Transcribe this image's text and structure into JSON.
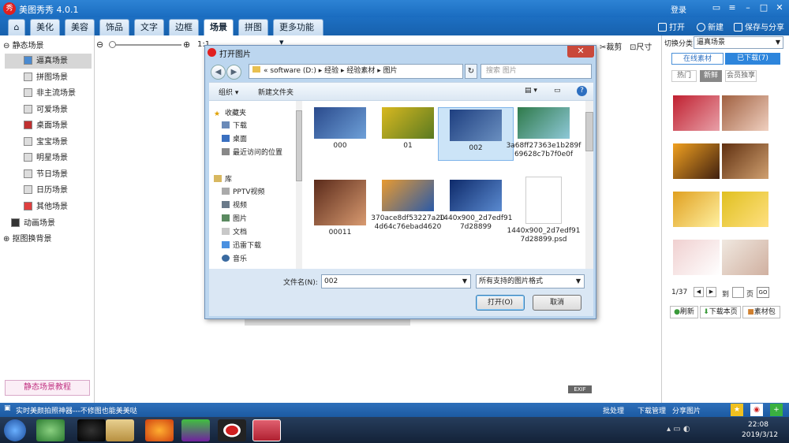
{
  "app": {
    "title": "美图秀秀 4.0.1",
    "logo": "秀",
    "login": "登录"
  },
  "menu": {
    "tabs": [
      "美化",
      "美容",
      "饰品",
      "文字",
      "边框",
      "场景",
      "拼图",
      "更多功能"
    ],
    "active": "场景",
    "open": "打开",
    "new": "新建",
    "save_share": "保存与分享"
  },
  "left": {
    "static_header": "静态场景",
    "items": [
      "逼真场景",
      "拼图场景",
      "非主流场景",
      "可爱场景",
      "桌面场景",
      "宝宝场景",
      "明星场景",
      "节日场景",
      "日历场景",
      "其他场景"
    ],
    "animated": "动画场景",
    "cutout": "抠图换背景",
    "tutorial": "静态场景教程"
  },
  "center": {
    "zoom_label": "1:1",
    "crop": "裁剪",
    "size": "尺寸"
  },
  "dialog": {
    "title": "打开图片",
    "path": [
      "software (D:)",
      "经验",
      "经验素材",
      "图片"
    ],
    "search_placeholder": "搜索 图片",
    "organize": "组织",
    "new_folder": "新建文件夹",
    "favorites": "收藏夹",
    "nav": [
      "下载",
      "桌面",
      "最近访问的位置"
    ],
    "library": "库",
    "lib_items": [
      "PPTV视频",
      "视频",
      "图片",
      "文档",
      "迅雷下载",
      "音乐"
    ],
    "files": [
      {
        "name": "000",
        "type": "img",
        "c1": "#2a4a8c",
        "c2": "#6ea0d8"
      },
      {
        "name": "01",
        "type": "img",
        "c1": "#d8b820",
        "c2": "#5a7a20"
      },
      {
        "name": "002",
        "type": "img",
        "c1": "#1e3f80",
        "c2": "#6a8fc0"
      },
      {
        "name": "3a68ff27363e1b289f69628c7b7f0e0f",
        "type": "img",
        "c1": "#2f7a4a",
        "c2": "#8ec8d8"
      },
      {
        "name": "00011",
        "type": "img",
        "c1": "#5a2a1a",
        "c2": "#d89a70"
      },
      {
        "name": "370ace8df53227a204d64c76ebad4620",
        "type": "img",
        "c1": "#e89a30",
        "c2": "#2a5aa8"
      },
      {
        "name": "1440x900_2d7edf917d28899",
        "type": "img",
        "c1": "#0e2a6a",
        "c2": "#5a8ad0"
      },
      {
        "name": "1440x900_2d7edf917d28899.psd",
        "type": "doc",
        "c1": "#ffffff",
        "c2": "#dddddd"
      }
    ],
    "filename_label": "文件名(N):",
    "filename_value": "002",
    "filter": "所有支持的图片格式",
    "open_btn": "打开(O)",
    "cancel_btn": "取消"
  },
  "right": {
    "category_label": "切换分类",
    "category_value": "逼真场景",
    "tab_online": "在线素材",
    "tab_downloaded": "已下载(7)",
    "subtabs": [
      "热门",
      "新鲜",
      "会员独享"
    ],
    "thumbs": [
      [
        "#c02030",
        "#e8a0a8"
      ],
      [
        "#a06040",
        "#f0d0c0"
      ],
      [
        "#f0a020",
        "#402010"
      ],
      [
        "#603010",
        "#d0a070"
      ],
      [
        "#e0a020",
        "#fff0a0"
      ],
      [
        "#e0c020",
        "#ffe080"
      ],
      [
        "#f0d0d0",
        "#fff"
      ],
      [
        "#f0e8e0",
        "#d0b0a0"
      ]
    ],
    "page_info": "1/37",
    "goto": "到",
    "page_unit": "页",
    "go": "GO",
    "refresh": "刷新",
    "download_page": "下载本页",
    "material_pack": "素材包"
  },
  "status": {
    "left": "实时美颜拍照神器---不修图也能美美哒",
    "batch": "批处理",
    "download_mgr": "下载管理",
    "share": "分享图片"
  },
  "taskbar": {
    "time": "22:08",
    "date": "2019/3/12"
  }
}
